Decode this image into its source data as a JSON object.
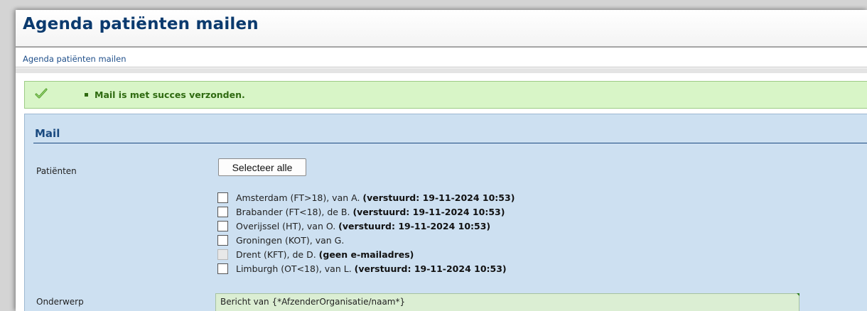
{
  "page": {
    "title": "Agenda patiënten mailen",
    "breadcrumb": "Agenda patiënten mailen"
  },
  "message": {
    "icon": "checkmark-icon",
    "text": "Mail is met succes verzonden.",
    "color": "#2e6a10"
  },
  "mail": {
    "heading": "Mail",
    "patients_label": "Patiënten",
    "select_all_label": "Selecteer alle",
    "patients": [
      {
        "name": "Amsterdam (FT>18), van A. ",
        "status": "(verstuurd: 19-11-2024 10:53)",
        "enabled": true,
        "checked": false
      },
      {
        "name": "Brabander (FT<18), de B. ",
        "status": "(verstuurd: 19-11-2024 10:53)",
        "enabled": true,
        "checked": false
      },
      {
        "name": "Overijssel (HT), van O. ",
        "status": "(verstuurd: 19-11-2024 10:53)",
        "enabled": true,
        "checked": false
      },
      {
        "name": "Groningen (KOT), van G.",
        "status": "",
        "enabled": true,
        "checked": false
      },
      {
        "name": "Drent (KFT), de D. ",
        "status": "(geen e-mailadres)",
        "enabled": false,
        "checked": false
      },
      {
        "name": "Limburgh (OT<18), van L. ",
        "status": "(verstuurd: 19-11-2024 10:53)",
        "enabled": true,
        "checked": false
      }
    ],
    "subject_label": "Onderwerp",
    "subject_value": "Bericht van {*AfzenderOrganisatie/naam*}"
  }
}
